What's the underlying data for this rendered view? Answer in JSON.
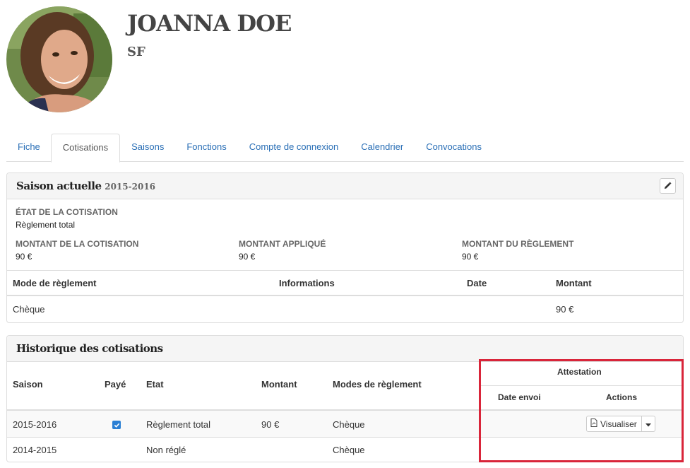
{
  "profile": {
    "name": "JOANNA DOE",
    "subtitle": "SF"
  },
  "tabs": [
    {
      "label": "Fiche",
      "active": false
    },
    {
      "label": "Cotisations",
      "active": true
    },
    {
      "label": "Saisons",
      "active": false
    },
    {
      "label": "Fonctions",
      "active": false
    },
    {
      "label": "Compte de connexion",
      "active": false
    },
    {
      "label": "Calendrier",
      "active": false
    },
    {
      "label": "Convocations",
      "active": false
    }
  ],
  "current_season": {
    "title": "Saison actuelle",
    "season": "2015-2016",
    "edit_icon": "pencil-icon",
    "status_label": "ÉTAT DE LA COTISATION",
    "status_value": "Règlement total",
    "fields": [
      {
        "label": "MONTANT DE LA COTISATION",
        "value": "90 €"
      },
      {
        "label": "MONTANT APPLIQUÉ",
        "value": "90 €"
      },
      {
        "label": "MONTANT DU RÈGLEMENT",
        "value": "90 €"
      }
    ],
    "payments_headers": [
      "Mode de règlement",
      "Informations",
      "Date",
      "Montant"
    ],
    "payments_rows": [
      {
        "mode": "Chèque",
        "informations": "",
        "date": "",
        "montant": "90 €"
      }
    ]
  },
  "history": {
    "title": "Historique des cotisations",
    "headers": {
      "saison": "Saison",
      "paye": "Payé",
      "etat": "Etat",
      "montant": "Montant",
      "modes": "Modes de règlement",
      "attestation": "Attestation",
      "date_envoi": "Date envoi",
      "actions": "Actions"
    },
    "rows": [
      {
        "saison": "2015-2016",
        "paye": true,
        "etat": "Règlement total",
        "montant": "90 €",
        "modes": "Chèque",
        "date_envoi": "",
        "action_label": "Visualiser"
      },
      {
        "saison": "2014-2015",
        "paye": false,
        "etat": "Non réglé",
        "montant": "",
        "modes": "Chèque",
        "date_envoi": "",
        "action_label": ""
      }
    ]
  },
  "colors": {
    "link": "#2a6fb6",
    "highlight": "#d9253a",
    "checkbox": "#2a7fd4"
  }
}
